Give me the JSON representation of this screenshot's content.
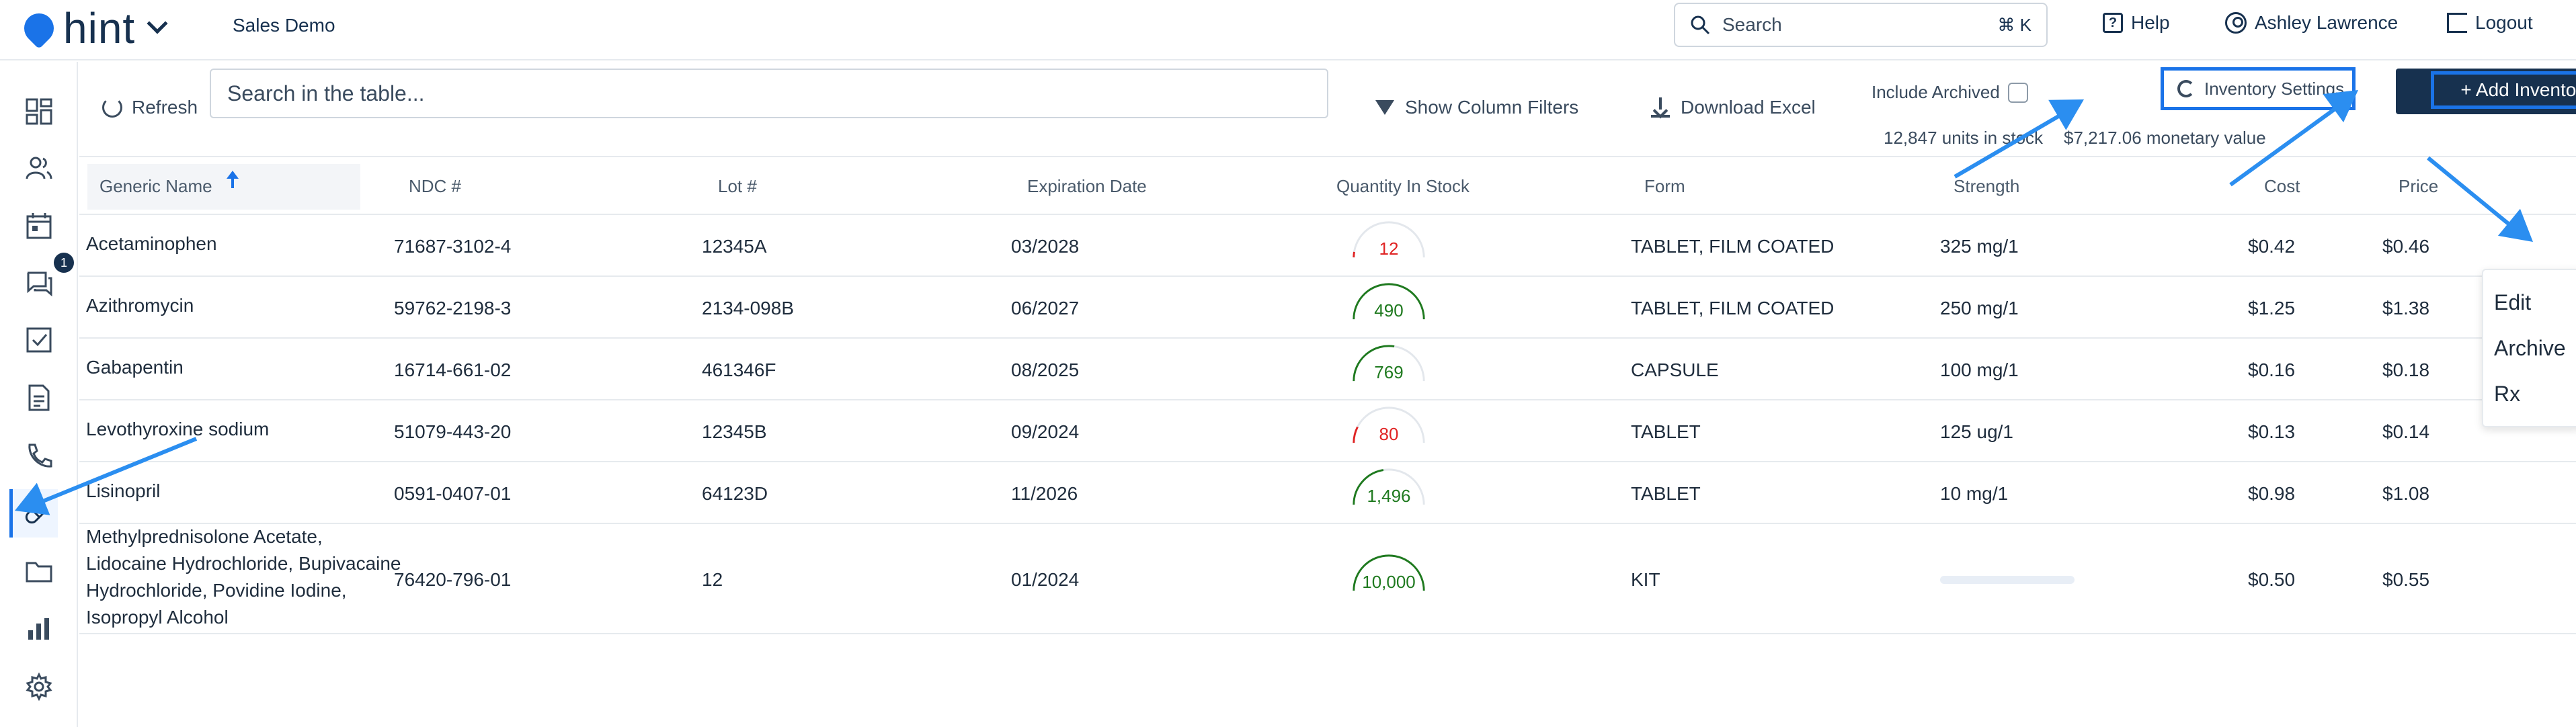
{
  "app": {
    "logo_text": "hint",
    "org_name": "Sales Demo"
  },
  "topbar": {
    "search_placeholder": "Search",
    "search_shortcut": "⌘ K",
    "help_label": "Help",
    "user_name": "Ashley Lawrence",
    "logout_label": "Logout"
  },
  "sidebar": {
    "items": [
      {
        "name": "dashboard-icon"
      },
      {
        "name": "patients-icon"
      },
      {
        "name": "calendar-icon"
      },
      {
        "name": "messages-icon",
        "badge": "1"
      },
      {
        "name": "tasks-icon"
      },
      {
        "name": "documents-icon"
      },
      {
        "name": "phone-icon"
      },
      {
        "name": "inventory-icon",
        "active": true
      },
      {
        "name": "folder-icon"
      },
      {
        "name": "reports-icon"
      },
      {
        "name": "settings-icon"
      }
    ]
  },
  "toolbar": {
    "refresh_label": "Refresh",
    "table_search_placeholder": "Search in the table...",
    "column_filters_label": "Show Column Filters",
    "download_label": "Download Excel",
    "include_archived_label": "Include Archived",
    "inventory_settings_label": "Inventory Settings",
    "add_inventory_label": "+ Add Inventory",
    "units_in_stock": "12,847 units in stock",
    "monetary_value": "$7,217.06 monetary value"
  },
  "table": {
    "columns": [
      "Generic Name",
      "NDC #",
      "Lot #",
      "Expiration Date",
      "Quantity In Stock",
      "Form",
      "Strength",
      "Cost",
      "Price"
    ],
    "rows": [
      {
        "name": [
          "Acetaminophen"
        ],
        "ndc": "71687-3102-4",
        "lot": "12345A",
        "exp": "03/2028",
        "qty": "12",
        "qty_level": 0.05,
        "qty_status": "low",
        "form": "TABLET, FILM COATED",
        "strength": "325 mg/1",
        "cost": "$0.42",
        "price": "$0.46"
      },
      {
        "name": [
          "Azithromycin"
        ],
        "ndc": "59762-2198-3",
        "lot": "2134-098B",
        "exp": "06/2027",
        "qty": "490",
        "qty_level": 1.0,
        "qty_status": "ok",
        "form": "TABLET, FILM COATED",
        "strength": "250 mg/1",
        "cost": "$1.25",
        "price": "$1.38"
      },
      {
        "name": [
          "Gabapentin"
        ],
        "ndc": "16714-661-02",
        "lot": "461346F",
        "exp": "08/2025",
        "qty": "769",
        "qty_level": 0.55,
        "qty_status": "ok",
        "form": "CAPSULE",
        "strength": "100 mg/1",
        "cost": "$0.16",
        "price": "$0.18"
      },
      {
        "name": [
          "Levothyroxine sodium"
        ],
        "ndc": "51079-443-20",
        "lot": "12345B",
        "exp": "09/2024",
        "qty": "80",
        "qty_level": 0.15,
        "qty_status": "low",
        "form": "TABLET",
        "strength": "125 ug/1",
        "cost": "$0.13",
        "price": "$0.14"
      },
      {
        "name": [
          "Lisinopril"
        ],
        "ndc": "0591-0407-01",
        "lot": "64123D",
        "exp": "11/2026",
        "qty": "1,496",
        "qty_level": 0.45,
        "qty_status": "ok",
        "form": "TABLET",
        "strength": "10 mg/1",
        "cost": "$0.98",
        "price": "$1.08"
      },
      {
        "name": [
          "Methylprednisolone Acetate,",
          "Lidocaine Hydrochloride, Bupivacaine",
          "Hydrochloride, Povidine Iodine,",
          "Isopropyl Alcohol"
        ],
        "ndc": "76420-796-01",
        "lot": "12",
        "exp": "01/2024",
        "qty": "10,000",
        "qty_level": 1.0,
        "qty_status": "ok",
        "form": "KIT",
        "strength": "",
        "cost": "$0.50",
        "price": "$0.55"
      }
    ]
  },
  "row_menu": {
    "items": [
      "Edit",
      "Archive",
      "Rx"
    ]
  },
  "colors": {
    "brand": "#17314f",
    "accent": "#1a73e8",
    "annotation": "#2b8ef0",
    "low_stock": "#e02424",
    "ok_stock": "#1f7a1f"
  }
}
